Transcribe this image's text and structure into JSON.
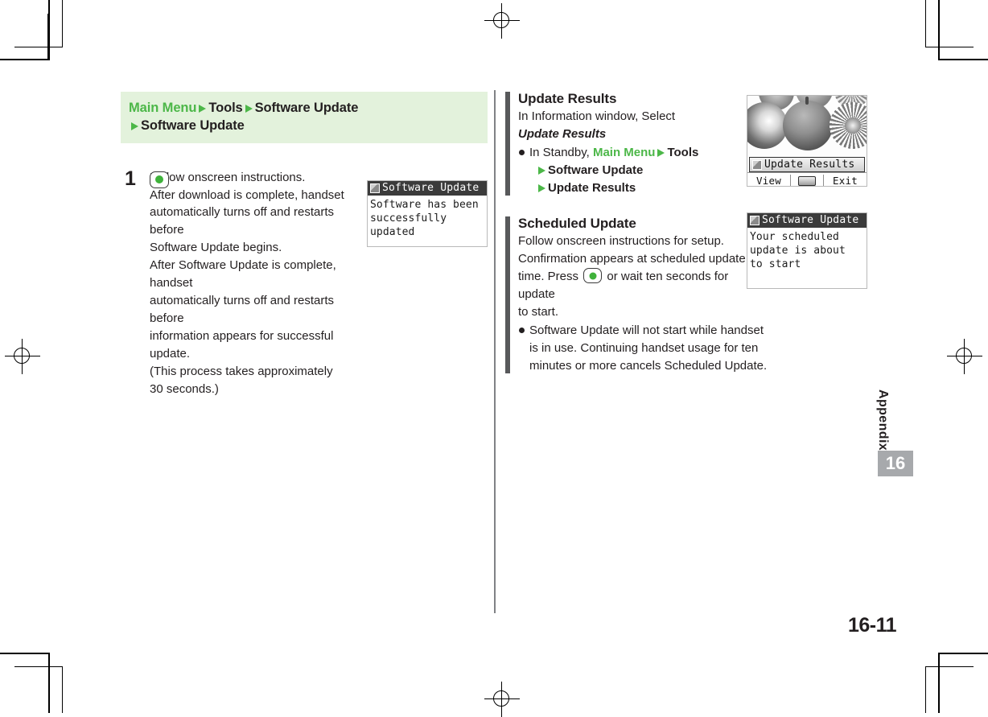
{
  "page": {
    "number": "16-11",
    "chapter_tab": "16",
    "section_label": "Appendix"
  },
  "left_column": {
    "breadcrumb": {
      "line1": [
        {
          "text": "Main Menu",
          "style": "green"
        },
        {
          "text": "Tools",
          "style": "dark"
        },
        {
          "text": "Software Update",
          "style": "dark"
        }
      ],
      "line2": [
        {
          "text": "Software Update",
          "style": "dark"
        }
      ]
    },
    "step": {
      "number": "1",
      "key_icon": "center-select-key",
      "lines": [
        "Follow onscreen instructions.",
        "After download is complete, handset",
        "automatically turns off and restarts before",
        "Software Update begins.",
        "After Software Update is complete, handset",
        "automatically turns off and restarts before",
        "information appears for successful update.",
        "(This process takes approximately",
        "30 seconds.)"
      ]
    },
    "screenshot": {
      "title": "Software Update",
      "lines": [
        "Software has been",
        "successfully",
        "updated"
      ]
    }
  },
  "right_column": {
    "sections": [
      {
        "title": "Update Results",
        "text": "In Information window, Select",
        "emphasis": "Update Results",
        "bullet": "In Standby,",
        "bullet_menu": "Main Menu",
        "bullet_menu2": "Tools",
        "sub1": "Software Update",
        "sub2": "Update Results"
      },
      {
        "title": "Scheduled Update",
        "line1": "Follow onscreen instructions for setup.",
        "line2": "Confirmation appears at scheduled update",
        "line3_a": "time. Press",
        "line3_b": "or wait ten seconds for update",
        "line4": "to start.",
        "bullet": "Software Update will not start while handset is in use. Continuing handset usage for ten minutes or more cancels Scheduled Update."
      }
    ],
    "screenshot_results": {
      "popup_label": "Update Results",
      "softkey_left": "View",
      "softkey_center": "center-key-icon",
      "softkey_right": "Exit"
    },
    "screenshot_scheduled": {
      "title": "Software Update",
      "lines": [
        "Your scheduled",
        "update is about",
        "to start"
      ]
    }
  },
  "colors": {
    "accent_green": "#4cb748",
    "breadcrumb_bg": "#e3f2dc",
    "section_bar": "#58595b",
    "tab_gray": "#a7a9ac",
    "text": "#231f20"
  }
}
